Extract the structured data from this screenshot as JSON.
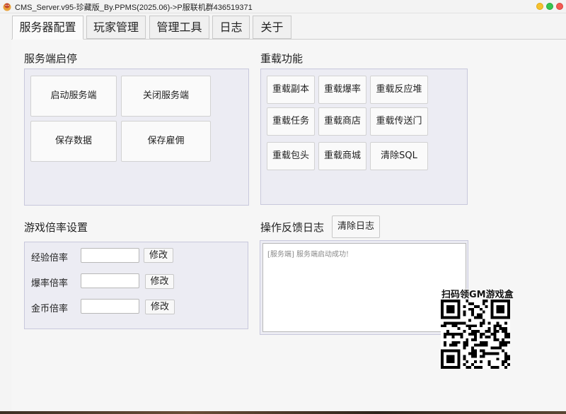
{
  "window": {
    "title": "CMS_Server.v95-珍藏版_By.PPMS(2025.06)->P服联机群436519371"
  },
  "tabs": [
    {
      "label": "服务器配置",
      "active": true
    },
    {
      "label": "玩家管理",
      "active": false
    },
    {
      "label": "管理工具",
      "active": false
    },
    {
      "label": "日志",
      "active": false
    },
    {
      "label": "关于",
      "active": false
    }
  ],
  "server_control": {
    "title": "服务端启停",
    "buttons": [
      "启动服务端",
      "关闭服务端",
      "保存数据",
      "保存雇佣"
    ]
  },
  "reload": {
    "title": "重载功能",
    "buttons": [
      "重载副本",
      "重载爆率",
      "重载反应堆",
      "重载任务",
      "重载商店",
      "重载传送门",
      "重载包头",
      "重载商城",
      "清除SQL"
    ]
  },
  "rates": {
    "title": "游戏倍率设置",
    "rows": [
      {
        "label": "经验倍率",
        "value": "",
        "button": "修改"
      },
      {
        "label": "爆率倍率",
        "value": "",
        "button": "修改"
      },
      {
        "label": "金币倍率",
        "value": "",
        "button": "修改"
      }
    ]
  },
  "log": {
    "title": "操作反馈日志",
    "clear_button": "清除日志",
    "text": "[服务端] 服务端启动成功!"
  },
  "promo": {
    "qr_title": "扫码领GM游戏盒"
  },
  "colors": {
    "panel_bg": "#ececf3",
    "panel_border": "#c8c8dc",
    "win_yellow": "#f5c12e",
    "win_green": "#36c451",
    "win_red": "#f25a53"
  }
}
